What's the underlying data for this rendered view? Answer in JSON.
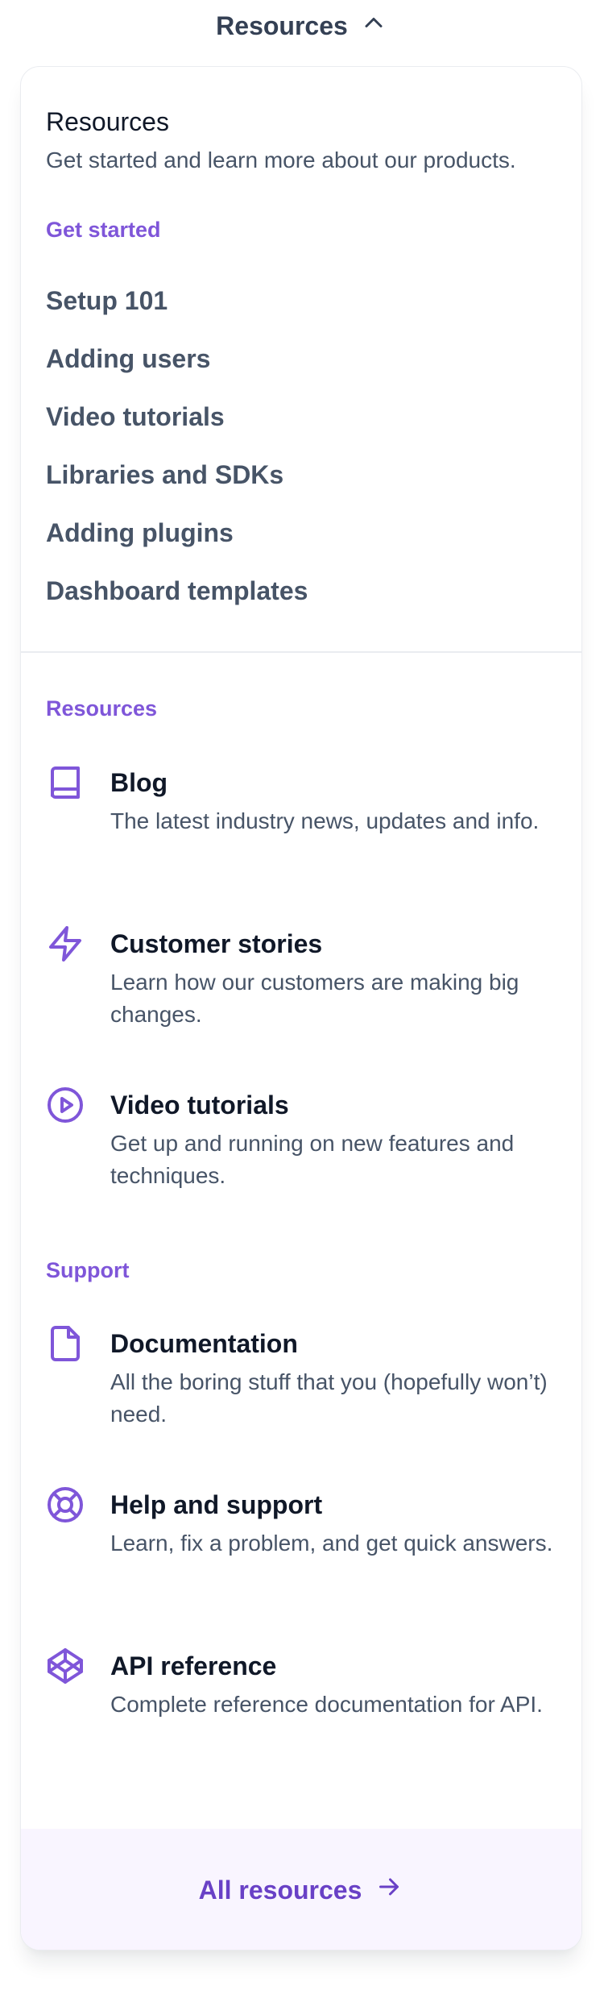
{
  "trigger": {
    "label": "Resources",
    "icon": "chevron-up-icon"
  },
  "intro": {
    "title": "Resources",
    "subtitle": "Get started and learn more about our products."
  },
  "get_started": {
    "heading": "Get started",
    "links": [
      "Setup 101",
      "Adding users",
      "Video tutorials",
      "Libraries and SDKs",
      "Adding plugins",
      "Dashboard templates"
    ]
  },
  "resources": {
    "heading": "Resources",
    "items": [
      {
        "icon": "book-icon",
        "title": "Blog",
        "description": "The latest industry news, updates and info."
      },
      {
        "icon": "lightning-icon",
        "title": "Customer stories",
        "description": "Learn how our customers are making big changes."
      },
      {
        "icon": "play-circle-icon",
        "title": "Video tutorials",
        "description": "Get up and running on new features and techniques."
      }
    ]
  },
  "support": {
    "heading": "Support",
    "items": [
      {
        "icon": "file-icon",
        "title": "Documentation",
        "description": "All the boring stuff that you (hopefully won’t) need."
      },
      {
        "icon": "life-buoy-icon",
        "title": "Help and support",
        "description": "Learn, fix a problem, and get quick answers."
      },
      {
        "icon": "codepen-icon",
        "title": "API reference",
        "description": "Complete reference documentation for API."
      }
    ]
  },
  "footer": {
    "label": "All resources",
    "icon": "arrow-right-icon"
  },
  "colors": {
    "accent": "#7f56d9",
    "accent_dark": "#6941c6",
    "footer_bg": "#f9f5ff"
  }
}
